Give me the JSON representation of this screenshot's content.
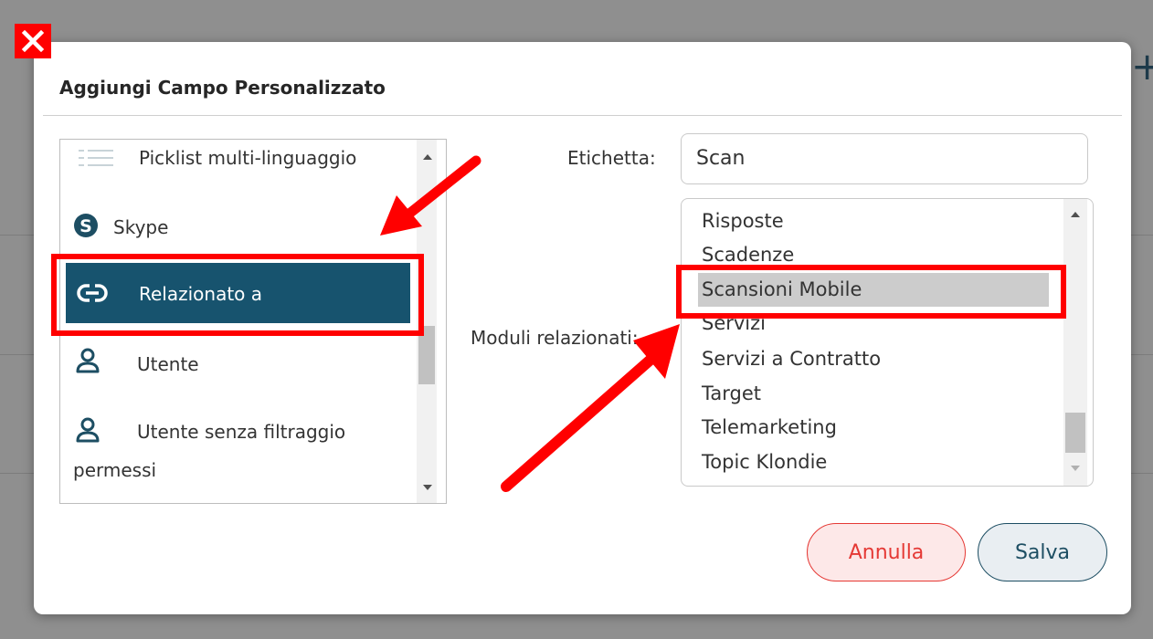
{
  "dialog": {
    "title": "Aggiungi Campo Personalizzato"
  },
  "field_types": {
    "items": [
      {
        "label": "Picklist multi-linguaggio",
        "icon": "picklist-icon"
      },
      {
        "label": "Skype",
        "icon": "skype-icon"
      },
      {
        "label": "Relazionato a",
        "icon": "link-icon",
        "selected": true
      },
      {
        "label": "Utente",
        "icon": "user-icon"
      },
      {
        "label": "Utente senza filtraggio",
        "label_line2": "permessi",
        "icon": "user-icon"
      }
    ]
  },
  "form": {
    "label_label": "Etichetta:",
    "label_value": "Scan",
    "modules_label": "Moduli relazionati:"
  },
  "modules": {
    "items": [
      "Risposte",
      "Scadenze",
      "Scansioni Mobile",
      "Servizi",
      "Servizi a Contratto",
      "Target",
      "Telemarketing",
      "Topic Klondie"
    ],
    "selected": "Scansioni Mobile"
  },
  "buttons": {
    "cancel_label": "Annulla",
    "save_label": "Salva"
  },
  "colors": {
    "selected_bg": "#17536e",
    "annotation_red": "#ff0000",
    "cancel": "#e53935",
    "save": "#1d4e63"
  }
}
